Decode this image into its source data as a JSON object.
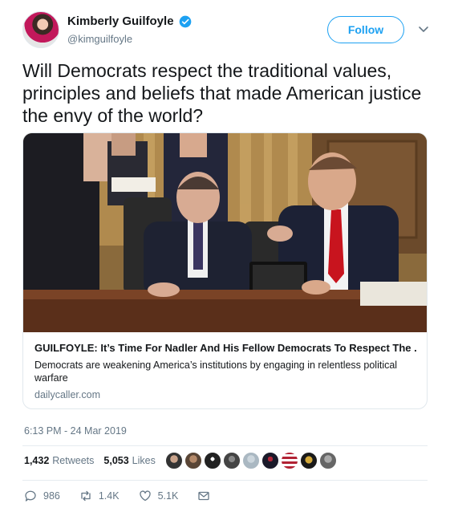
{
  "author": {
    "name": "Kimberly Guilfoyle",
    "handle": "@kimguilfoyle",
    "verified": true
  },
  "follow_label": "Follow",
  "tweet": {
    "text": "Will Democrats respect the traditional values, principles and beliefs that made American justice the envy of the world?"
  },
  "card": {
    "title": "GUILFOYLE: It’s Time For Nadler And His Fellow Democrats To Respect The ...",
    "description": "Democrats are weakening America’s institutions by engaging in relentless political warfare",
    "domain": "dailycaller.com"
  },
  "timestamp": "6:13 PM - 24 Mar 2019",
  "stats": {
    "retweets_count": "1,432",
    "retweets_label": "Retweets",
    "likes_count": "5,053",
    "likes_label": "Likes"
  },
  "actions": {
    "replies": "986",
    "retweets": "1.4K",
    "likes": "5.1K"
  },
  "colors": {
    "accent": "#1da1f2",
    "muted": "#657786",
    "text": "#14171a",
    "border": "#e1e8ed"
  },
  "icons": [
    "verified-badge-icon",
    "chevron-down-icon",
    "reply-icon",
    "retweet-icon",
    "like-icon",
    "direct-message-icon"
  ]
}
